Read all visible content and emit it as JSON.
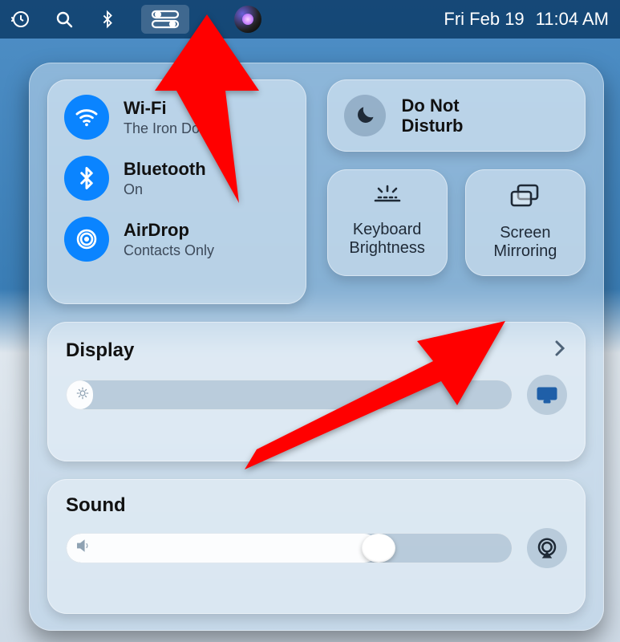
{
  "menubar": {
    "date": "Fri Feb 19",
    "time": "11:04 AM"
  },
  "connectivity": {
    "wifi": {
      "title": "Wi-Fi",
      "subtitle": "The Iron Dome"
    },
    "bluetooth": {
      "title": "Bluetooth",
      "subtitle": "On"
    },
    "airdrop": {
      "title": "AirDrop",
      "subtitle": "Contacts Only"
    }
  },
  "dnd": {
    "title_line1": "Do Not",
    "title_line2": "Disturb"
  },
  "keyboard_brightness": {
    "label_line1": "Keyboard",
    "label_line2": "Brightness"
  },
  "screen_mirroring": {
    "label_line1": "Screen",
    "label_line2": "Mirroring"
  },
  "display": {
    "title": "Display",
    "level_percent": 6
  },
  "sound": {
    "title": "Sound",
    "level_percent": 70
  }
}
